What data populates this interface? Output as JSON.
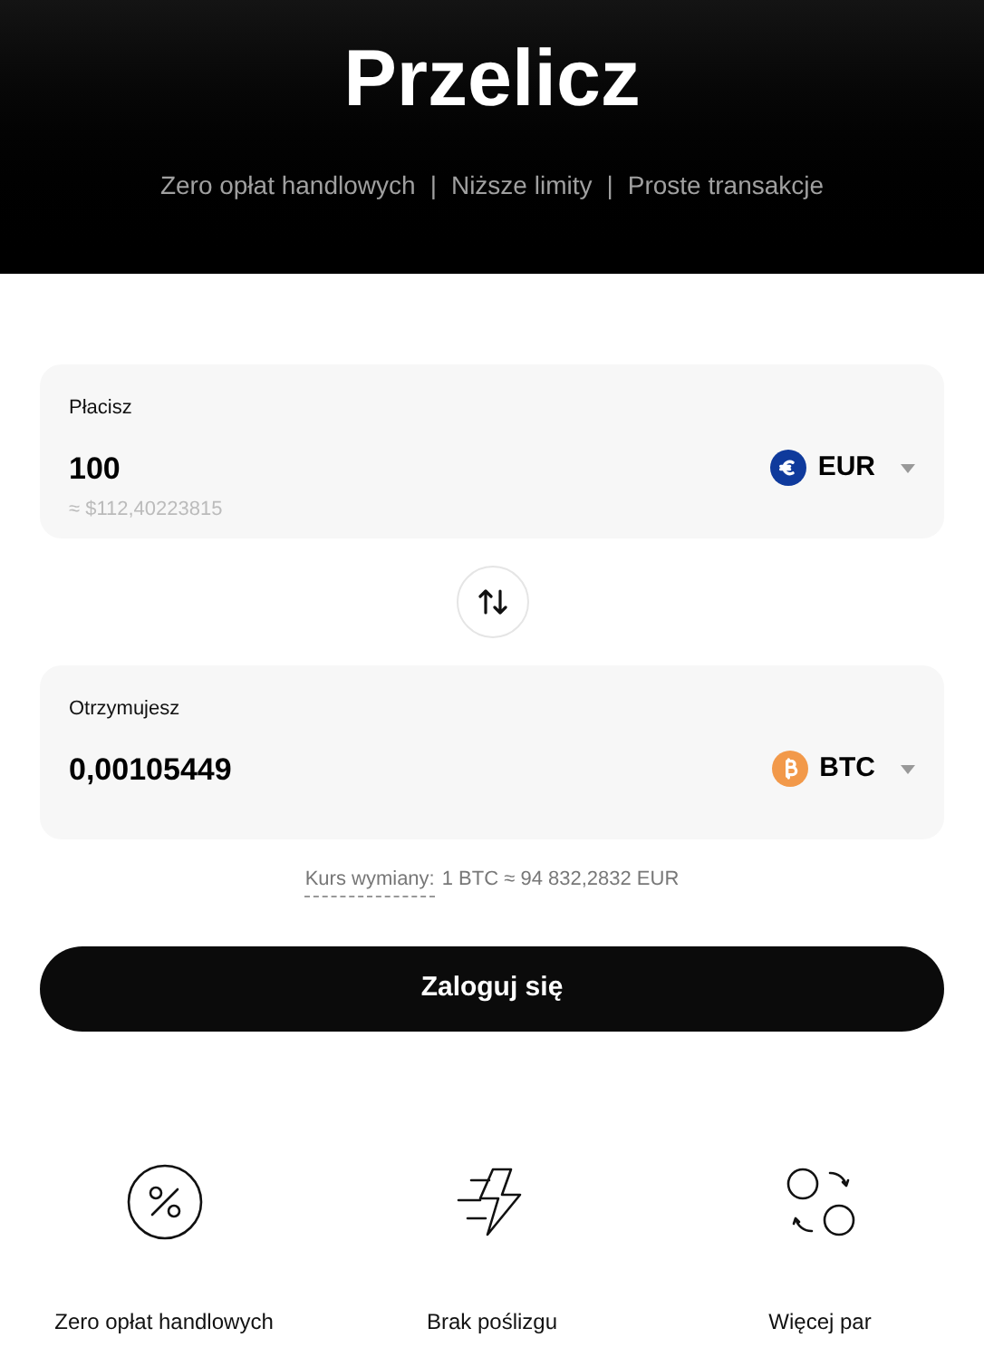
{
  "header": {
    "title": "Przelicz",
    "highlights": [
      "Zero opłat handlowych",
      "Niższe limity",
      "Proste transakcje"
    ],
    "separator": "|"
  },
  "pay": {
    "label": "Płacisz",
    "value": "100",
    "equivalent": "≈ $112,40223815",
    "currency": {
      "code": "EUR",
      "kind": "euro",
      "color": "#0f3a9c"
    }
  },
  "receive": {
    "label": "Otrzymujesz",
    "value": "0,00105449",
    "currency": {
      "code": "BTC",
      "kind": "bitcoin",
      "color": "#f2994a"
    }
  },
  "rate": {
    "label": "Kurs wymiany:",
    "value": "1 BTC ≈ 94 832,2832 EUR"
  },
  "login_button": "Zaloguj się",
  "features": [
    {
      "kind": "percent",
      "label": "Zero opłat handlowych"
    },
    {
      "kind": "lightning",
      "label": "Brak poślizgu"
    },
    {
      "kind": "pairs",
      "label": "Więcej par"
    }
  ]
}
